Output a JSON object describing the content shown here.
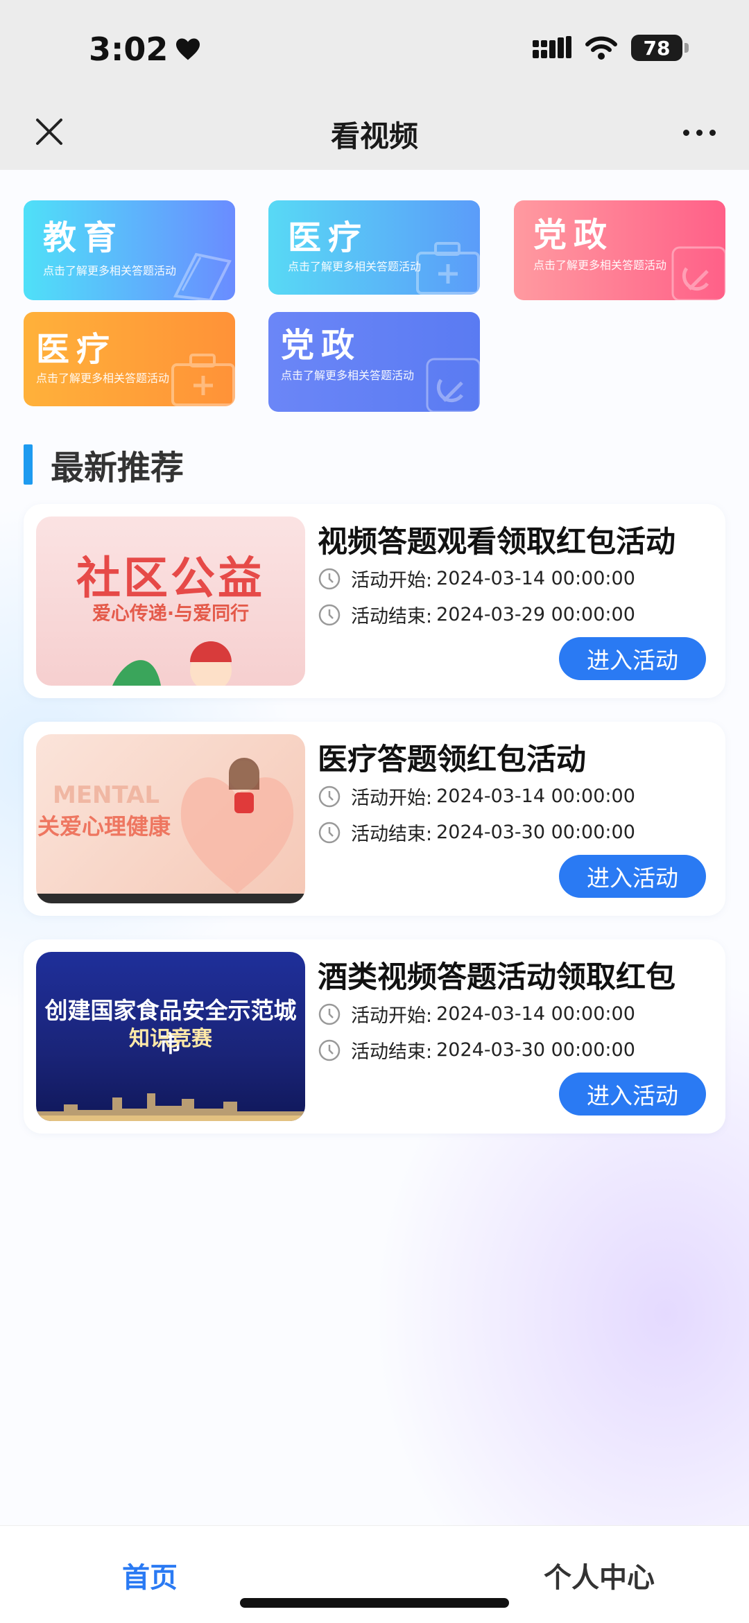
{
  "status_bar": {
    "time": "3:02",
    "battery": "78"
  },
  "nav": {
    "title": "看视频",
    "close_icon": "close-icon",
    "more_icon": "more-icon"
  },
  "categories": [
    {
      "title": "教育",
      "subtitle": "点击了解更多相关答题活动",
      "icon": "book-icon",
      "color_from": "#4fe0f8",
      "color_to": "#6a8cff"
    },
    {
      "title": "医疗",
      "subtitle": "点击了解更多相关答题活动",
      "icon": "medkit-icon",
      "color_from": "#58d9f5",
      "color_to": "#5b9cf9"
    },
    {
      "title": "党政",
      "subtitle": "点击了解更多相关答题活动",
      "icon": "party-emblem-icon",
      "color_from": "#ff9aa0",
      "color_to": "#ff6088"
    },
    {
      "title": "医疗",
      "subtitle": "点击了解更多相关答题活动",
      "icon": "medkit-icon",
      "color_from": "#ffb13a",
      "color_to": "#ff9238"
    },
    {
      "title": "党政",
      "subtitle": "点击了解更多相关答题活动",
      "icon": "party-emblem-icon",
      "color_from": "#6b86f7",
      "color_to": "#5a7bf2"
    }
  ],
  "section": {
    "title": "最新推荐"
  },
  "activities": [
    {
      "title": "视频答题观看领取红包活动",
      "start_label": "活动开始:",
      "start": "2024-03-14 00:00:00",
      "end_label": "活动结束:",
      "end": "2024-03-29 00:00:00",
      "button": "进入活动",
      "thumb_main": "社区公益",
      "thumb_sub": "爱心传递·与爱同行"
    },
    {
      "title": "医疗答题领红包活动",
      "start_label": "活动开始:",
      "start": "2024-03-14 00:00:00",
      "end_label": "活动结束:",
      "end": "2024-03-30 00:00:00",
      "button": "进入活动",
      "thumb_en": "MENTAL",
      "thumb_main": "关爱心理健康"
    },
    {
      "title": "酒类视频答题活动领取红包",
      "start_label": "活动开始:",
      "start": "2024-03-14 00:00:00",
      "end_label": "活动结束:",
      "end": "2024-03-30 00:00:00",
      "button": "进入活动",
      "thumb_main": "创建国家食品安全示范城市",
      "thumb_sub": "知识竞赛"
    }
  ],
  "tabs": {
    "home": "首页",
    "me": "个人中心"
  },
  "colors": {
    "accent": "#2a7af3",
    "section_bar": "#1e9bf0"
  }
}
